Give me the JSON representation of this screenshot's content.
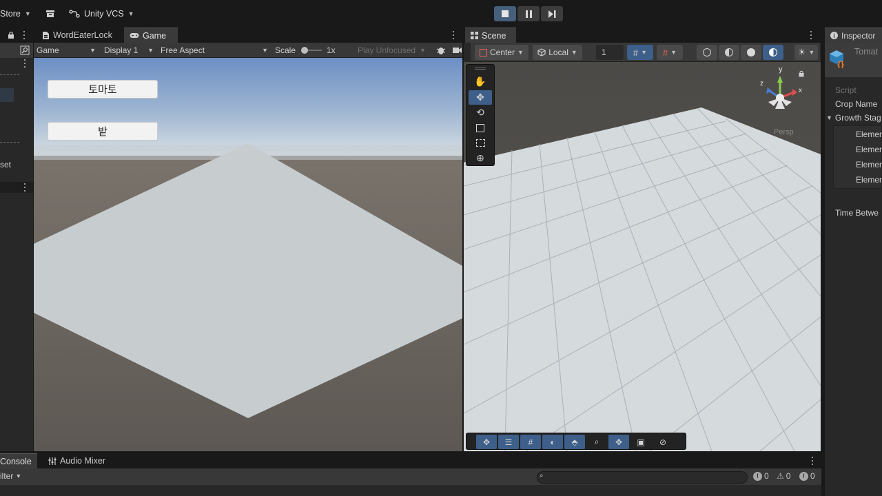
{
  "toolbar": {
    "store_label": "Store",
    "vcs_label": "Unity VCS",
    "play_controls": [
      "stop",
      "pause",
      "step"
    ]
  },
  "left_panel": {
    "fragment_label": "set"
  },
  "game_panel": {
    "tabs": [
      {
        "label": "WordEaterLock",
        "icon": "scene-icon"
      },
      {
        "label": "Game",
        "icon": "gamepad-icon",
        "active": true
      }
    ],
    "toolbar": {
      "view": "Game",
      "display": "Display 1",
      "aspect": "Free Aspect",
      "scale_label": "Scale",
      "scale_value": "1x",
      "play_focus": "Play Unfocused"
    },
    "buttons": [
      {
        "label": "토마토"
      },
      {
        "label": "밭"
      }
    ]
  },
  "scene_panel": {
    "tab_label": "Scene",
    "toolbar": {
      "pivot": "Center",
      "space": "Local",
      "grid_snap": "1"
    },
    "gizmo": {
      "y_label": "y",
      "z_label": "z",
      "x_label": "x",
      "persp_label": "Persp"
    },
    "tools": [
      "hand-tool",
      "move-tool",
      "rotate-tool",
      "scale-tool",
      "rect-tool",
      "transform-tool"
    ],
    "overlay_items": 9
  },
  "inspector": {
    "tab_label": "Inspector",
    "object_name": "Tomat",
    "rows": {
      "script": "Script",
      "crop_name": "Crop Name",
      "growth_stage": "Growth Stag",
      "elements": [
        "Elemen",
        "Elemen",
        "Elemen",
        "Elemen"
      ],
      "time_between": "Time Betwe"
    }
  },
  "bottom_panel": {
    "tabs": [
      {
        "label": "Console",
        "active": true
      },
      {
        "label": "Audio Mixer"
      }
    ],
    "filter_label": "ilter",
    "counts": {
      "errors": "0",
      "warnings": "0",
      "info": "0"
    }
  },
  "colors": {
    "accent": "#3d5f8a",
    "panel": "#282828",
    "toolbar": "#191919",
    "game_sky": "#7a99c6",
    "game_ground": "#68615a",
    "plane": "#c6cbce",
    "scene_grid": "#d3d9dd"
  }
}
